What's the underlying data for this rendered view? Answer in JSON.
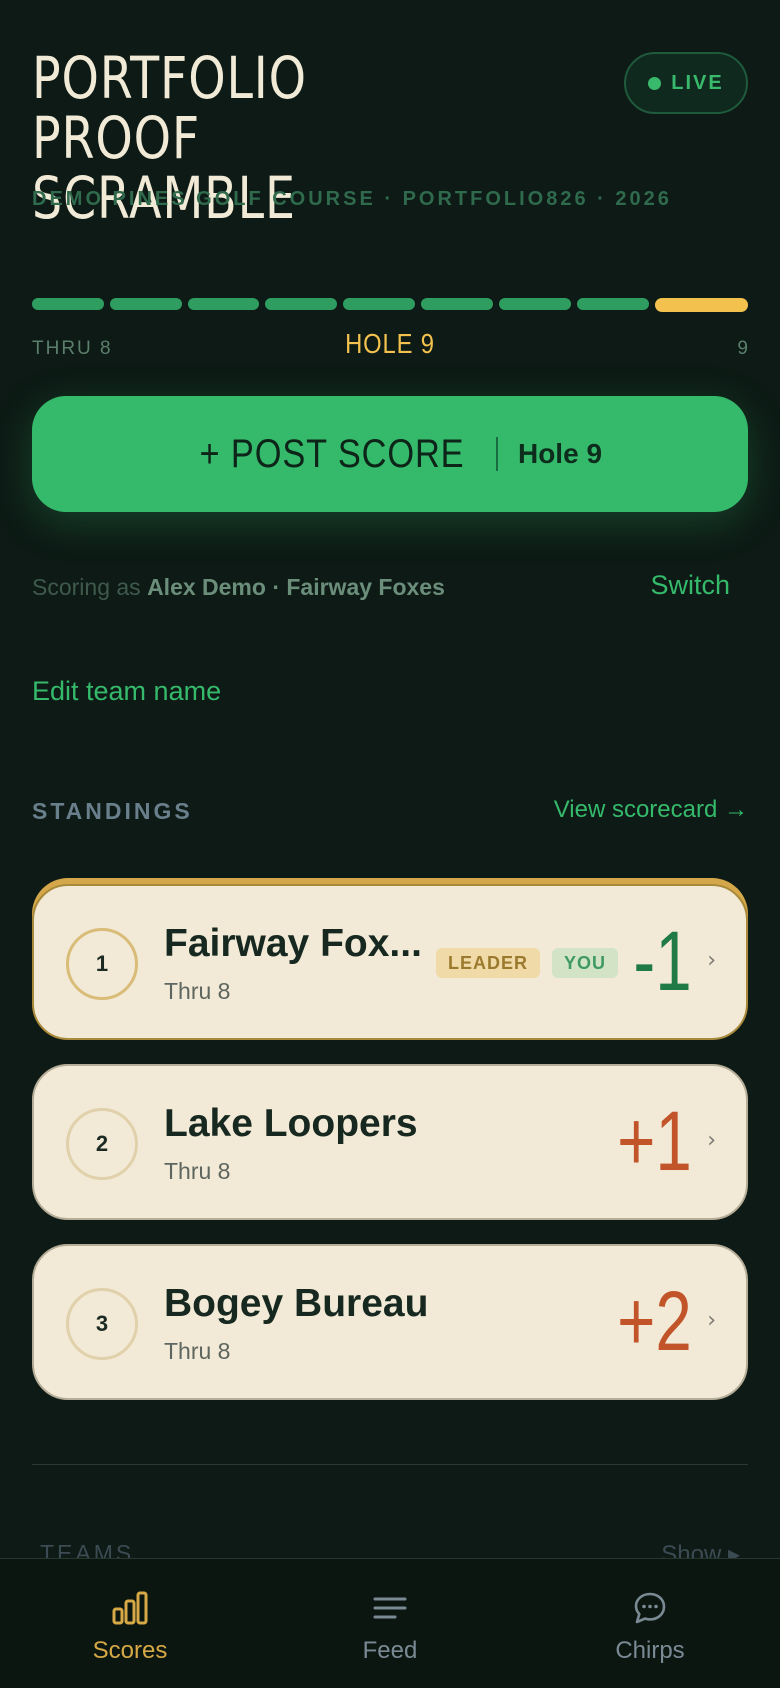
{
  "header": {
    "title_line1": "PORTFOLIO PROOF",
    "title_line2": "SCRAMBLE",
    "live_label": "LIVE",
    "subtitle": "DEMO PINES GOLF COURSE · PORTFOLIO826 · 2026"
  },
  "progress": {
    "holes_completed": 8,
    "current_hole": 9,
    "total_holes": 9,
    "thru_label": "THRU 8",
    "hole_label": "HOLE 9",
    "end_label": "9"
  },
  "post_score": {
    "label": "+ POST SCORE",
    "hole": "Hole 9"
  },
  "scoring": {
    "prefix": "Scoring as",
    "who": "Alex Demo · Fairway Foxes",
    "switch_label": "Switch",
    "edit_team_label": "Edit team name"
  },
  "standings": {
    "heading": "STANDINGS",
    "view_scorecard": "View scorecard →",
    "teams": [
      {
        "rank": "1",
        "name": "Fairway Fox...",
        "thru": "Thru 8",
        "score": "-1",
        "leader_badge": "LEADER",
        "you_badge": "YOU"
      },
      {
        "rank": "2",
        "name": "Lake Loopers",
        "thru": "Thru 8",
        "score": "+1"
      },
      {
        "rank": "3",
        "name": "Bogey Bureau",
        "thru": "Thru 8",
        "score": "+2"
      }
    ]
  },
  "teams_section": {
    "heading": "TEAMS",
    "show_label": "Show"
  },
  "nav": {
    "items": [
      {
        "label": "Scores",
        "icon": "bar-chart-icon"
      },
      {
        "label": "Feed",
        "icon": "lines-icon"
      },
      {
        "label": "Chirps",
        "icon": "chat-bubble-icon"
      }
    ]
  },
  "colors": {
    "background": "#0d1a15",
    "accent_green": "#35ba6c",
    "accent_gold": "#f2c14e",
    "card": "#f2ead7",
    "over_par": "#c2542a",
    "under_par": "#1f7a45"
  }
}
